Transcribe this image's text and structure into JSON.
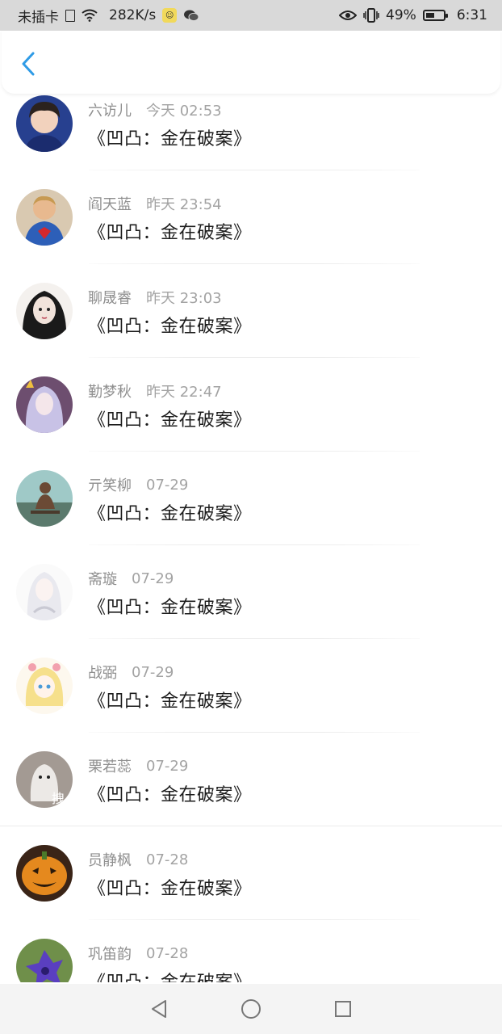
{
  "status_bar": {
    "carrier": "未插卡",
    "speed": "282K/s",
    "battery": "49%",
    "battery_level": 0.49,
    "time": "6:31"
  },
  "header": {
    "back_icon": "chevron-left-icon",
    "accent_color": "#2f9be6"
  },
  "comments": [
    {
      "name": "六访儿",
      "time": "今天 02:53",
      "text": "《凹凸：金在破案》"
    },
    {
      "name": "阎天蓝",
      "time": "昨天 23:54",
      "text": "《凹凸：金在破案》"
    },
    {
      "name": "聊晟睿",
      "time": "昨天 23:03",
      "text": "《凹凸：金在破案》"
    },
    {
      "name": "勤梦秋",
      "time": "昨天 22:47",
      "text": "《凹凸：金在破案》"
    },
    {
      "name": "亓笑柳",
      "time": "07-29",
      "text": "《凹凸：金在破案》"
    },
    {
      "name": "斋璇",
      "time": "07-29",
      "text": "《凹凸：金在破案》"
    },
    {
      "name": "战弼",
      "time": "07-29",
      "text": "《凹凸：金在破案》"
    },
    {
      "name": "栗若蕊",
      "time": "07-29",
      "text": "《凹凸：金在破案》"
    },
    {
      "name": "员静枫",
      "time": "07-28",
      "text": "《凹凸：金在破案》"
    },
    {
      "name": "巩笛韵",
      "time": "07-28",
      "text": "《凹凸：金在破案》"
    }
  ],
  "avatar_badge": "拽",
  "nav_bar": {
    "back": "triangle-back-icon",
    "home": "circle-home-icon",
    "recents": "square-recents-icon"
  }
}
